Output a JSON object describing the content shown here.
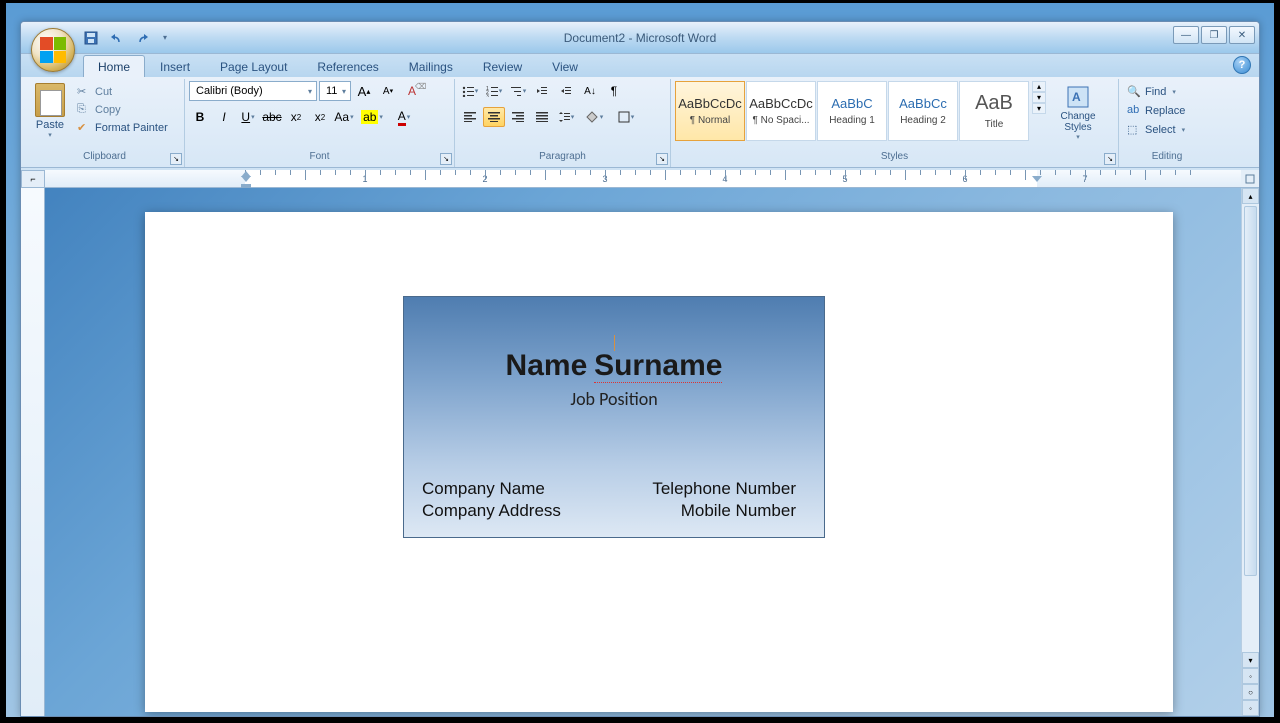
{
  "title": "Document2 - Microsoft Word",
  "tabs": [
    "Home",
    "Insert",
    "Page Layout",
    "References",
    "Mailings",
    "Review",
    "View"
  ],
  "active_tab": 0,
  "clipboard": {
    "paste": "Paste",
    "cut": "Cut",
    "copy": "Copy",
    "format_painter": "Format Painter",
    "label": "Clipboard"
  },
  "font": {
    "name": "Calibri (Body)",
    "size": "11",
    "label": "Font"
  },
  "paragraph": {
    "label": "Paragraph"
  },
  "styles": {
    "label": "Styles",
    "change": "Change Styles",
    "items": [
      {
        "preview": "AaBbCcDc",
        "label": "¶ Normal",
        "sel": true,
        "cls": ""
      },
      {
        "preview": "AaBbCcDc",
        "label": "¶ No Spaci...",
        "sel": false,
        "cls": ""
      },
      {
        "preview": "AaBbC",
        "label": "Heading 1",
        "sel": false,
        "cls": "blue"
      },
      {
        "preview": "AaBbCc",
        "label": "Heading 2",
        "sel": false,
        "cls": "blue"
      },
      {
        "preview": "AaB",
        "label": "Title",
        "sel": false,
        "cls": "big"
      }
    ]
  },
  "editing": {
    "find": "Find",
    "replace": "Replace",
    "select": "Select",
    "label": "Editing"
  },
  "card": {
    "name_first": "Name",
    "name_last": "Surname",
    "job": "Job Position",
    "company": "Company Name",
    "address": "Company Address",
    "phone": "Telephone Number",
    "mobile": "Mobile Number"
  },
  "ruler_numbers": [
    "1",
    "2",
    "3",
    "4",
    "5",
    "6",
    "7"
  ]
}
